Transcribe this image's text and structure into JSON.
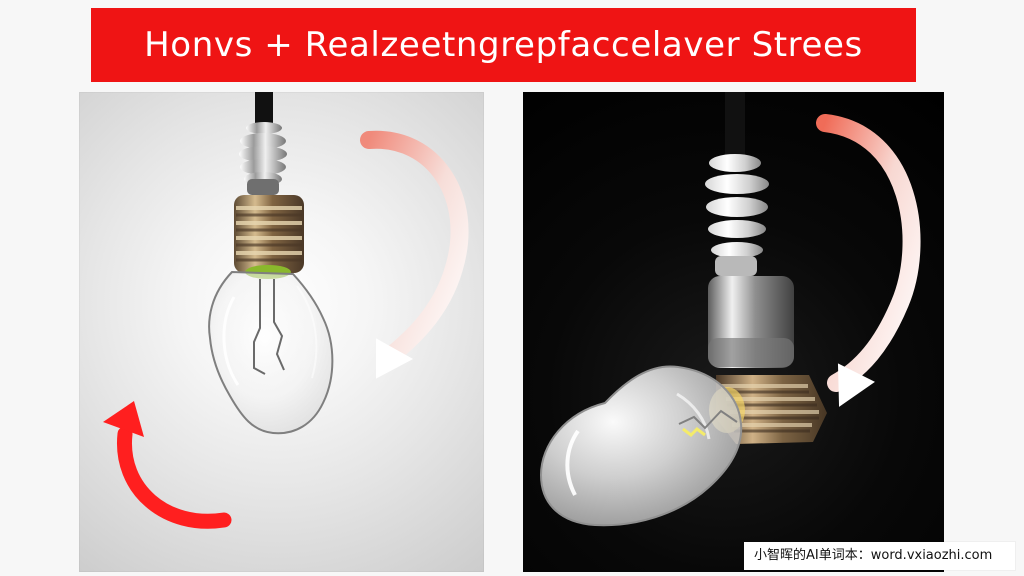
{
  "banner": {
    "title": "Honvs + Realzeetngrepfaccelaver Strees"
  },
  "watermark": {
    "text": "小智晖的AI单词本：word.vxiaozhi.com"
  },
  "colors": {
    "banner_red": "#ef1414",
    "arrow_red": "#ff1f1f",
    "arrow_pink": "#f08a7b",
    "panel_left_background": "#e7e7e7",
    "panel_right_background": "#000000"
  },
  "icons": {
    "left_main_arrow": "curved-arrow-down-left",
    "left_small_arrow": "curved-arrow-up-left",
    "right_main_arrow": "curved-arrow-down-left"
  }
}
